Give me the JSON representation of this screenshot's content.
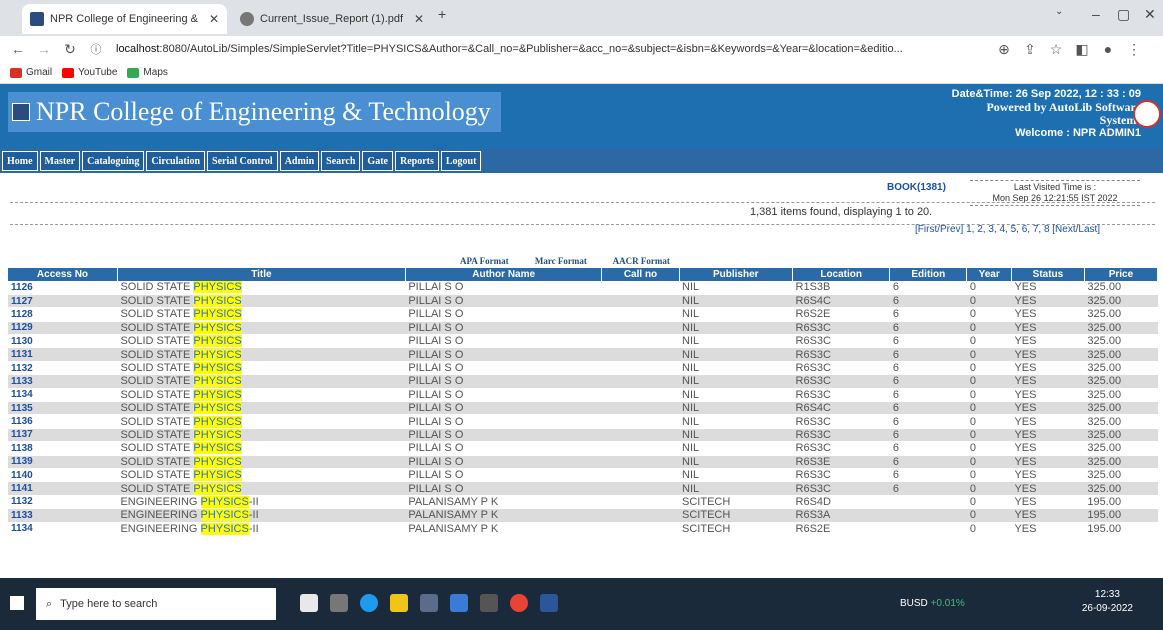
{
  "browser": {
    "tabs": [
      {
        "label": "NPR College of Engineering & Te",
        "active": true
      },
      {
        "label": "Current_Issue_Report (1).pdf",
        "active": false
      }
    ],
    "url_host": "localhost",
    "url_rest": ":8080/AutoLib/Simples/SimpleServlet?Title=PHYSICS&Author=&Call_no=&Publisher=&acc_no=&subject=&isbn=&Keywords=&Year=&location=&editio...",
    "bookmarks": [
      "Gmail",
      "YouTube",
      "Maps"
    ]
  },
  "header": {
    "college": "NPR College of Engineering & Technology",
    "datetime_label": "Date&Time:",
    "datetime": "26 Sep 2022, 12 : 33 : 09",
    "powered": "Powered by AutoLib Software",
    "systems": "Systems",
    "welcome": "Welcome   :  NPR ADMIN1"
  },
  "menu": [
    "Home",
    "Master",
    "Cataloguing",
    "Circulation",
    "Serial Control",
    "Admin",
    "Search",
    "Gate",
    "Reports",
    "Logout"
  ],
  "summary": {
    "book_count": "BOOK(1381)",
    "last_visited_label": "Last Visited Time is :",
    "last_visited": "Mon Sep 26 12:21:55 IST 2022",
    "found": "1,381 items found, displaying 1 to 20.",
    "pager": "[First/Prev] 1, 2, 3, 4, 5, 6, 7, 8 [Next/Last]"
  },
  "formats": [
    "APA Format",
    "Marc Format",
    "AACR Format"
  ],
  "table": {
    "headers": [
      "Access No",
      "Title",
      "Author Name",
      "Call no",
      "Publisher",
      "Location",
      "Edition",
      "Year",
      "Status",
      "Price"
    ],
    "rows": [
      [
        "1126",
        "SOLID STATE ",
        "PHYSICS",
        "",
        "PILLAI S O",
        "",
        "NIL",
        "R1S3B",
        "6",
        "0",
        "YES",
        "325.00"
      ],
      [
        "1127",
        "SOLID STATE ",
        "PHYSICS",
        "",
        "PILLAI S O",
        "",
        "NIL",
        "R6S4C",
        "6",
        "0",
        "YES",
        "325.00"
      ],
      [
        "1128",
        "SOLID STATE ",
        "PHYSICS",
        "",
        "PILLAI S O",
        "",
        "NIL",
        "R6S2E",
        "6",
        "0",
        "YES",
        "325.00"
      ],
      [
        "1129",
        "SOLID STATE ",
        "PHYSICS",
        "",
        "PILLAI S O",
        "",
        "NIL",
        "R6S3C",
        "6",
        "0",
        "YES",
        "325.00"
      ],
      [
        "1130",
        "SOLID STATE ",
        "PHYSICS",
        "",
        "PILLAI S O",
        "",
        "NIL",
        "R6S3C",
        "6",
        "0",
        "YES",
        "325.00"
      ],
      [
        "1131",
        "SOLID STATE ",
        "PHYSICS",
        "",
        "PILLAI S O",
        "",
        "NIL",
        "R6S3C",
        "6",
        "0",
        "YES",
        "325.00"
      ],
      [
        "1132",
        "SOLID STATE ",
        "PHYSICS",
        "",
        "PILLAI S O",
        "",
        "NIL",
        "R6S3C",
        "6",
        "0",
        "YES",
        "325.00"
      ],
      [
        "1133",
        "SOLID STATE ",
        "PHYSICS",
        "",
        "PILLAI S O",
        "",
        "NIL",
        "R6S3C",
        "6",
        "0",
        "YES",
        "325.00"
      ],
      [
        "1134",
        "SOLID STATE ",
        "PHYSICS",
        "",
        "PILLAI S O",
        "",
        "NIL",
        "R6S3C",
        "6",
        "0",
        "YES",
        "325.00"
      ],
      [
        "1135",
        "SOLID STATE ",
        "PHYSICS",
        "",
        "PILLAI S O",
        "",
        "NIL",
        "R6S4C",
        "6",
        "0",
        "YES",
        "325.00"
      ],
      [
        "1136",
        "SOLID STATE ",
        "PHYSICS",
        "",
        "PILLAI S O",
        "",
        "NIL",
        "R6S3C",
        "6",
        "0",
        "YES",
        "325.00"
      ],
      [
        "1137",
        "SOLID STATE ",
        "PHYSICS",
        "",
        "PILLAI S O",
        "",
        "NIL",
        "R6S3C",
        "6",
        "0",
        "YES",
        "325.00"
      ],
      [
        "1138",
        "SOLID STATE ",
        "PHYSICS",
        "",
        "PILLAI S O",
        "",
        "NIL",
        "R6S3C",
        "6",
        "0",
        "YES",
        "325.00"
      ],
      [
        "1139",
        "SOLID STATE ",
        "PHYSICS",
        "",
        "PILLAI S O",
        "",
        "NIL",
        "R6S3E",
        "6",
        "0",
        "YES",
        "325.00"
      ],
      [
        "1140",
        "SOLID STATE ",
        "PHYSICS",
        "",
        "PILLAI S O",
        "",
        "NIL",
        "R6S3C",
        "6",
        "0",
        "YES",
        "325.00"
      ],
      [
        "1141",
        "SOLID STATE ",
        "PHYSICS",
        "",
        "PILLAI S O",
        "",
        "NIL",
        "R6S3C",
        "6",
        "0",
        "YES",
        "325.00"
      ],
      [
        "1132",
        "ENGINEERING ",
        "PHYSICS",
        "-II",
        "PALANISAMY P K",
        "",
        "SCITECH",
        "R6S4D",
        "",
        "0",
        "YES",
        "195.00"
      ],
      [
        "1133",
        "ENGINEERING ",
        "PHYSICS",
        "-II",
        "PALANISAMY P K",
        "",
        "SCITECH",
        "R6S3A",
        "",
        "0",
        "YES",
        "195.00"
      ],
      [
        "1134",
        "ENGINEERING ",
        "PHYSICS",
        "-II",
        "PALANISAMY P K",
        "",
        "SCITECH",
        "R6S2E",
        "",
        "0",
        "YES",
        "195.00"
      ]
    ]
  },
  "taskbar": {
    "search_placeholder": "Type here to search",
    "ticker": "BUSD",
    "ticker_change": "+0.01%",
    "time": "12:33",
    "date": "26-09-2022"
  }
}
